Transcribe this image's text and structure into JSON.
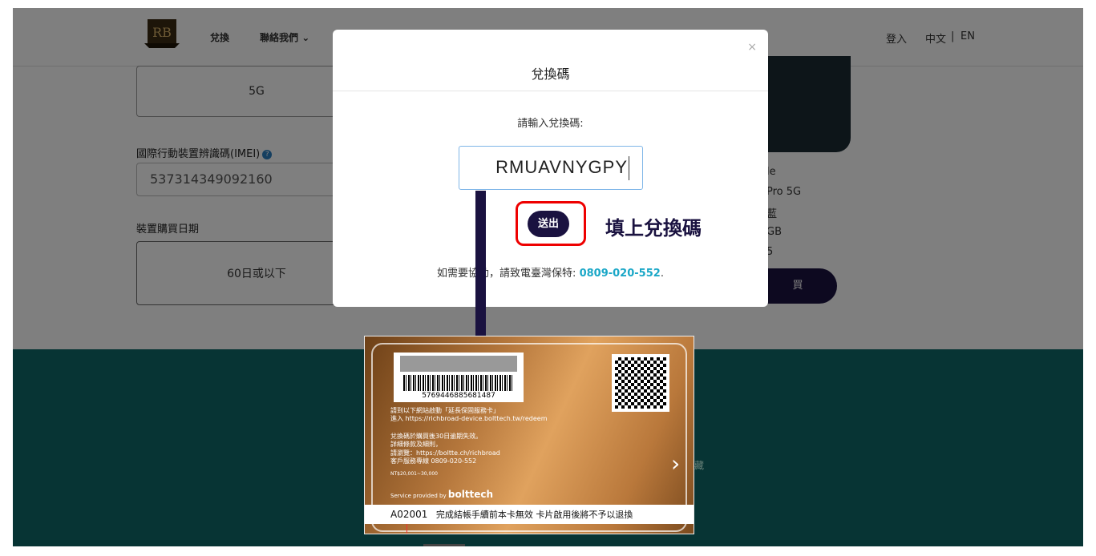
{
  "header": {
    "logo": "RB",
    "nav": [
      "兌換",
      "聯絡我們"
    ],
    "login": "登入",
    "lang_zh": "中文",
    "lang_sep": "|",
    "lang_en": "EN"
  },
  "form": {
    "network_value": "5G",
    "imei_label": "國際行動裝置辨識碼(IMEI)",
    "imei_value": "537314349092160",
    "purchase_label": "裝置購買日期",
    "purchase_value": "60日或以下"
  },
  "side": {
    "specs": [
      "le",
      "Pro 5G",
      "藍",
      "GB",
      "5"
    ],
    "buy_label": "買"
  },
  "teal": {
    "text": "藏"
  },
  "modal": {
    "close": "×",
    "title": "兌換碼",
    "prompt": "請輸入兌換碼:",
    "code_value": "RMUAVNYGPY",
    "submit": "送出",
    "annotation": "填上兌換碼",
    "help_prefix": "如需要協助，請致電臺灣保特: ",
    "help_phone": "0809-020-552",
    "help_suffix": "."
  },
  "card": {
    "barcode_number": "5769446885681487",
    "line1": "請到以下網站啟動「延長保固服務卡」",
    "line2": "進入 https://richbroad-device.bolttech.tw/redeem",
    "line3": "兌換碼於購買後30日逾期失效。",
    "line4": "詳細條款及細則，",
    "line5": "請瀏覽：https://boltte.ch/richbroad",
    "line6": "客戶服務專線 0809-020-552",
    "line7": "NT$20,001~30,000",
    "provided_by": "Service provided by ",
    "brand": "bolttech",
    "strip_code": "A02001",
    "strip_text": "完成結帳手續前本卡無效  卡片啟用後將不予以退換"
  }
}
